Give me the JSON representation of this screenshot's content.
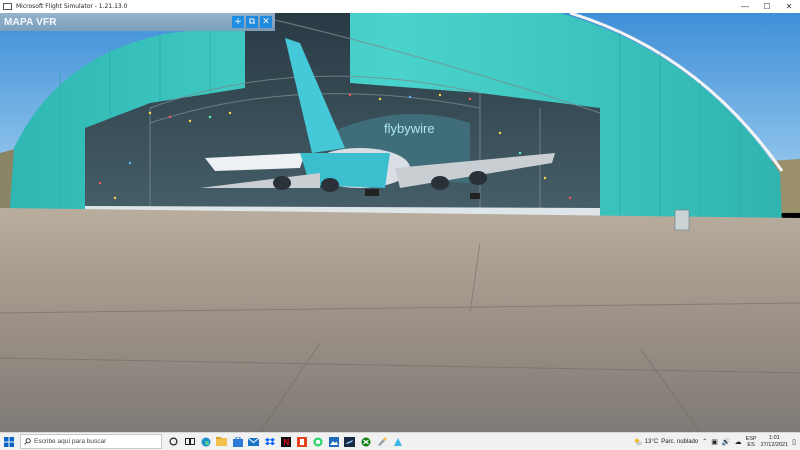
{
  "window": {
    "title": "Microsoft Flight Simulator - 1.21.13.0",
    "controls": [
      "—",
      "☐",
      "✕"
    ]
  },
  "vfr_map": {
    "title": "MAPA VFR",
    "buttons": [
      "+",
      "⧉",
      "✕"
    ]
  },
  "hangar": {
    "sign": "flybywire"
  },
  "taskbar": {
    "search_placeholder": "Escribe aquí para buscar",
    "icons": [
      "cortana-icon",
      "task-view-icon",
      "edge-icon",
      "file-explorer-icon",
      "store-icon",
      "mail-icon",
      "dropbox-icon",
      "netflix-icon",
      "office-icon",
      "whatsapp-icon",
      "photos-icon",
      "flight-sim-app-icon",
      "xbox-icon",
      "paint-icon",
      "taskbar-app-icon"
    ],
    "weather_temp": "13°C",
    "weather_text": "Parc. nublado",
    "lang_top": "ESP",
    "lang_bottom": "ES",
    "time": "1:01",
    "date": "27/12/2021"
  },
  "colors": {
    "hangar_teal": "#3bc9c4",
    "sky": "#6fb4e8",
    "accent_blue": "#1e8ee6"
  }
}
